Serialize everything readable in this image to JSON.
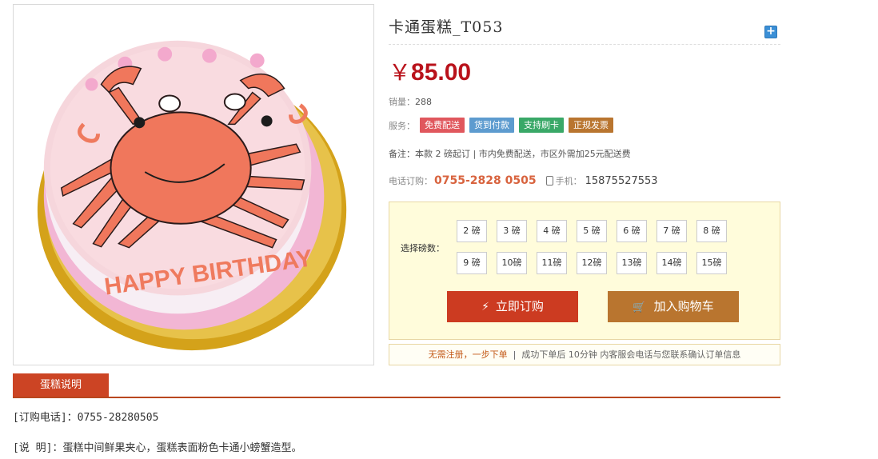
{
  "product": {
    "title": "卡通蛋糕_T053",
    "currency_symbol": "￥",
    "price": "85.00",
    "sales_label": "销量：",
    "sales_value": "288",
    "services_label": "服务：",
    "services": [
      {
        "label": "免费配送",
        "color": "#e0575d"
      },
      {
        "label": "货到付款",
        "color": "#5d9bcf"
      },
      {
        "label": "支持刷卡",
        "color": "#39a867"
      },
      {
        "label": "正规发票",
        "color": "#b9752f"
      }
    ],
    "note": "备注：本款 2 磅起订 | 市内免费配送，市区外需加25元配送费",
    "phone_label": "电话订购：",
    "phone": "0755-2828 0505",
    "mobile_label": "手机：",
    "mobile": "15875527553"
  },
  "order": {
    "select_label": "选择磅数：",
    "weights": [
      "2 磅",
      "3 磅",
      "4 磅",
      "5 磅",
      "6 磅",
      "7 磅",
      "8 磅",
      "9 磅",
      "10磅",
      "11磅",
      "12磅",
      "13磅",
      "14磅",
      "15磅"
    ],
    "buy_label": "立即订购",
    "cart_label": "加入购物车",
    "tip_highlight": "无需注册，一步下单",
    "tip_rest": "成功下单后 10分钟 内客服会电话与您联系确认订单信息"
  },
  "tabs": {
    "description_tab": "蛋糕说明"
  },
  "description": {
    "line1": "[订购电话]：0755-28280505",
    "line2": "[说 明]：蛋糕中间鲜果夹心，蛋糕表面粉色卡通小螃蟹造型。"
  },
  "image": {
    "cake_text": "HAPPY BIRTHDAY"
  }
}
